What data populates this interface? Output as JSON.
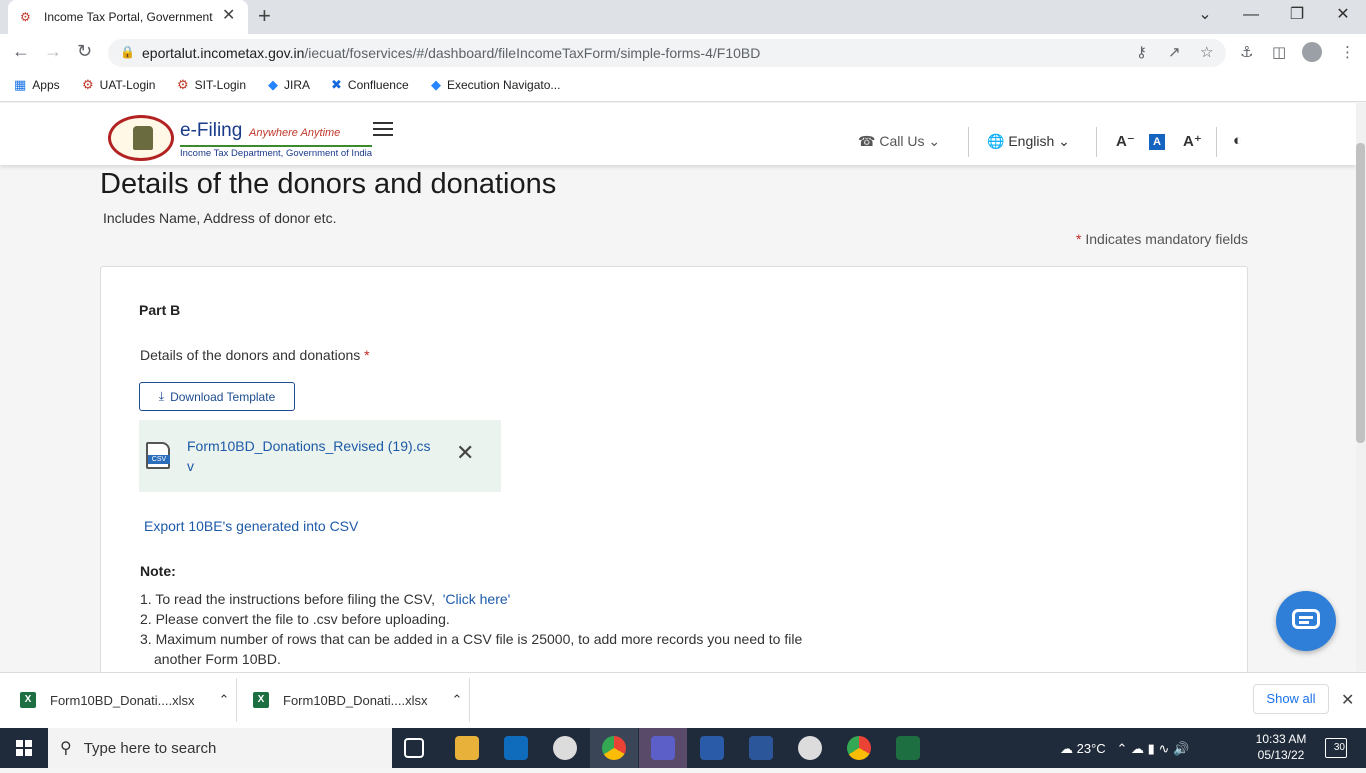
{
  "browser": {
    "tab_title": "Income Tax Portal, Government o",
    "url_domain": "eportalut.incometax.gov.in",
    "url_path": "/iecuat/foservices/#/dashboard/fileIncomeTaxForm/simple-forms-4/F10BD",
    "bookmarks": [
      "Apps",
      "UAT-Login",
      "SIT-Login",
      "JIRA",
      "Confluence",
      "Execution Navigato..."
    ]
  },
  "header": {
    "brand": "e-Filing",
    "tagline": "Anywhere Anytime",
    "subtitle": "Income Tax Department, Government of India",
    "call_us": "Call Us",
    "language": "English"
  },
  "page": {
    "title": "Details of the donors and donations",
    "subtitle": "Includes Name, Address of donor etc.",
    "mandatory_note": "Indicates mandatory fields",
    "part_label": "Part B",
    "field_label": "Details of the donors and donations",
    "download_template": "Download Template",
    "uploaded_file": "Form10BD_Donations_Revised (19).csv",
    "file_type": "CSV",
    "export_link": "Export 10BE's generated into CSV",
    "note_heading": "Note:",
    "note1_prefix": "To read the instructions before filing the CSV,",
    "note1_link": "'Click here'",
    "note2": "Please convert the file to .csv before uploading.",
    "note3_line1": "Maximum number of rows that can be added in a CSV file is 25000, to add more records you need to file",
    "note3_line2": "another Form 10BD."
  },
  "downloads": {
    "items": [
      "Form10BD_Donati....xlsx",
      "Form10BD_Donati....xlsx"
    ],
    "show_all": "Show all"
  },
  "taskbar": {
    "search_placeholder": "Type here to search",
    "temperature": "23°C",
    "time": "10:33 AM",
    "date": "05/13/22",
    "notifications": "30"
  },
  "colors": {
    "primary": "#1e4c8f",
    "link": "#1e5aa8",
    "required": "#c62828",
    "file_bg": "#eaf3ee"
  }
}
